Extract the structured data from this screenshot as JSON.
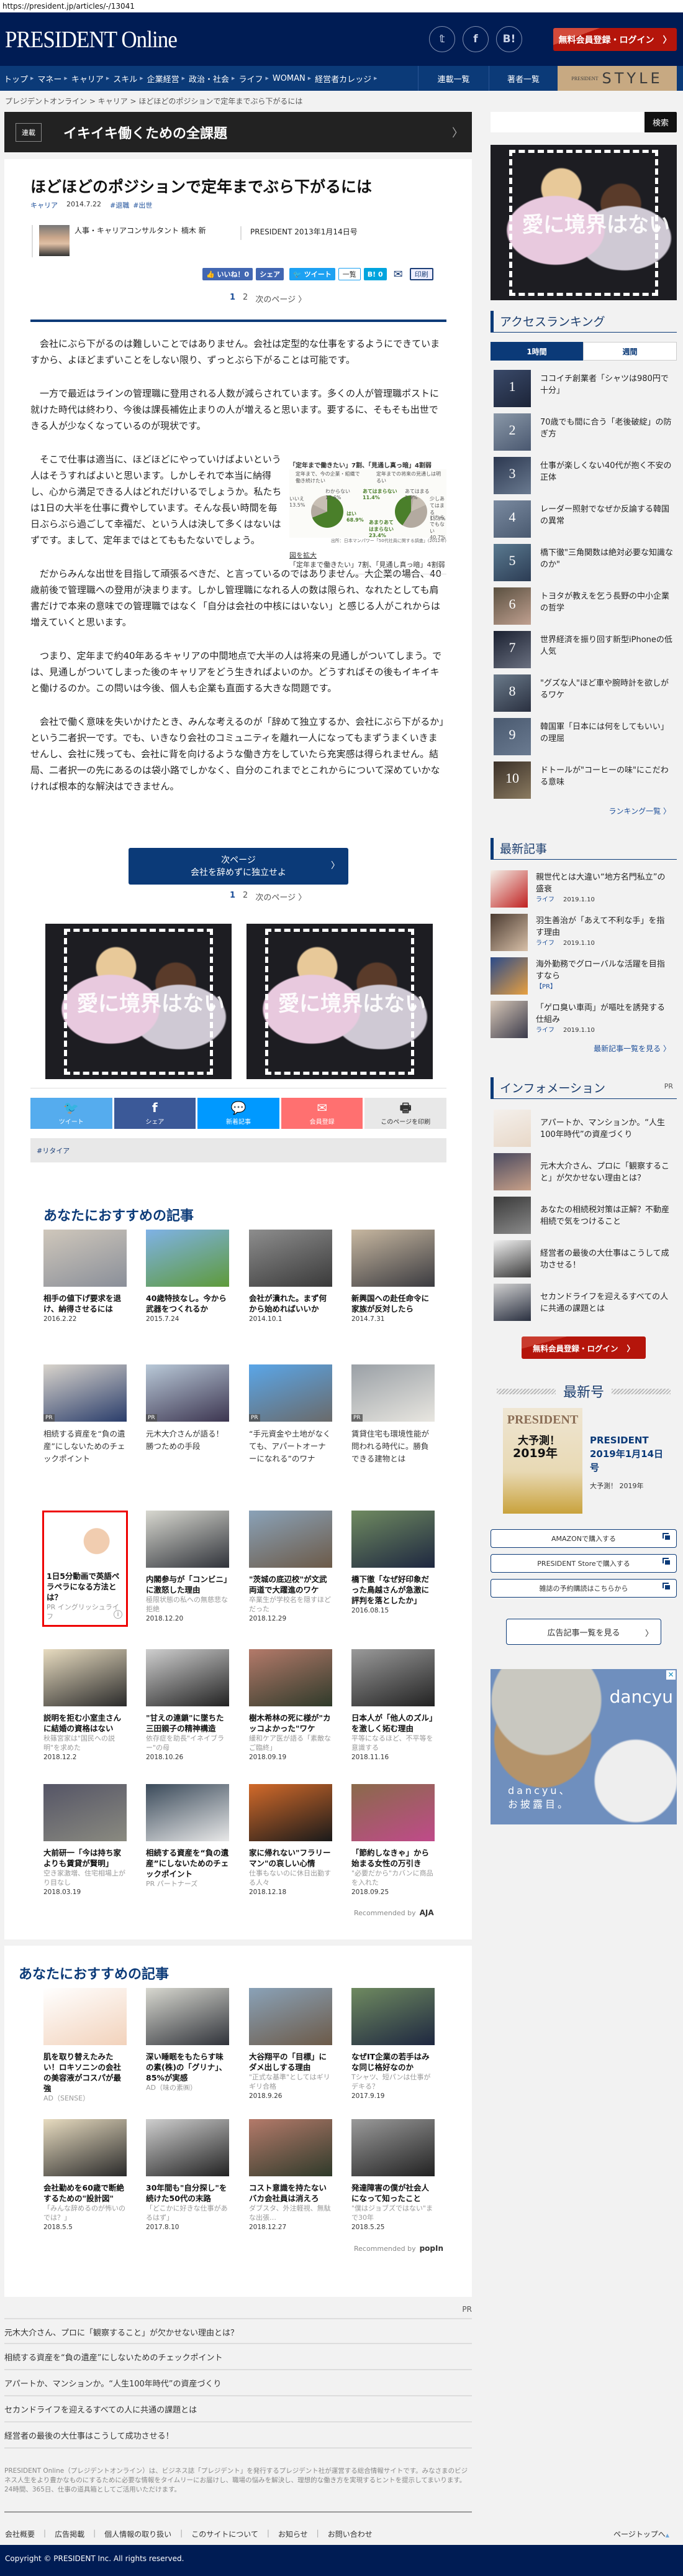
{
  "url": "https://president.jp/articles/-/13041",
  "header": {
    "logo": "PRESIDENT Online",
    "social": [
      {
        "icon": "twitter-icon",
        "label": "𝕥"
      },
      {
        "icon": "facebook-icon",
        "label": "f"
      },
      {
        "icon": "hatena-bookmark-icon",
        "label": "B!"
      }
    ],
    "login_label": "無料会員登録・ログイン",
    "login_chevron": "〉"
  },
  "nav": {
    "items": [
      "トップ",
      "マネー",
      "キャリア",
      "スキル",
      "企業経営",
      "政治・社会",
      "ライフ",
      "WOMAN",
      "経営者カレッジ"
    ],
    "series_list": "連載一覧",
    "authors_list": "著者一覧",
    "style_small": "PRESIDENT",
    "style_big": "STYLE"
  },
  "breadcrumb": "プレジデントオンライン  >  キャリア  >  ほどほどのポジションで定年までぶら下がるには",
  "series": {
    "tag": "連載",
    "title": "イキイキ働くための全課題",
    "chevron": "〉"
  },
  "article": {
    "title": "ほどほどのポジションで定年までぶら下がるには",
    "category": "キャリア",
    "date": "2014.7.22",
    "tags": [
      "#退職",
      "#出世"
    ],
    "author": "人事・キャリアコンサルタント 楠木 新",
    "issue": "PRESIDENT 2013年1月14日号",
    "share": {
      "like": "👍 いいね！0",
      "share": "シェア",
      "tweet": "🐦 ツイート",
      "list": "一覧",
      "hatena": "B! 0",
      "mail": "✉",
      "print": "印刷"
    },
    "pager": {
      "p1": "1",
      "p2": "2",
      "next": "次のページ 〉"
    },
    "paragraphs": [
      "会社にぶら下がるのは難しいことではありません。会社は定型的な仕事をするようにできていますから、よほどまずいことをしない限り、ずっとぶら下がることは可能です。",
      "一方で最近はラインの管理職に登用される人数が減らされています。多くの人が管理職ポストに就けた時代は終わり、今後は課長補佐止まりの人が増えると思います。要するに、そもそも出世できる人が少なくなっているのが現状です。",
      "そこで仕事は適当に、ほどほどにやっていけばよいという人はそうすればよいと思います。しかしそれで本当に納得し、心から満足できる人はどれだけいるでしょうか。私たちは1日の大半を仕事に費やしています。そんな長い時間を毎日ぶらぶら過ごして幸福だ、という人は決して多くはないはずです。まして、定年まではとてももたないでしょう。",
      "だからみんな出世を目指して頑張るべきだ、と言っているのではありません。大企業の場合、40歳前後で管理職への登用が決まります。しかし管理職になれる人の数は限られ、なれたとしても肩書だけで本来の意味での管理職ではなく「自分は会社の中核にはいない」と感じる人がこれからは増えていくと思います。",
      "つまり、定年まで約40年あるキャリアの中間地点で大半の人は将来の見通しがついてしまう。では、見通しがついてしまった後のキャリアをどう生きればよいのか。どうすればその後もイキイキと働けるのか。この問いは今後、個人も企業も直面する大きな問題です。",
      "会社で働く意味を失いかけたとき、みんな考えるのが「辞めて独立するか、会社にぶら下がるか」という二者択一です。でも、いきなり会社のコミュニティを離れ一人になってもまずうまくいきませんし、会社に残っても、会社に背を向けるような働き方をしていたら充実感は得られません。結局、二者択一の先にあるのは袋小路でしかなく、自分のこれまでとこれからについて深めていかなければ根本的な解決はできません。"
    ],
    "figure": {
      "title": "「定年まで働きたい」7割、「見通し真っ暗」4割弱",
      "left_q": "定年まで、今の企業・組織で働き続けたい",
      "right_q": "定年までの将来の見通しは明るい",
      "left_labels": [
        "いいえ 13.5%",
        "わからない 17.6%",
        "はい 68.9%"
      ],
      "right_labels": [
        "あてはまらない 11.4%",
        "あてはまる 2.9%",
        "少しあてはまる 15.3%",
        "あまりあてはまらない 23.4%",
        "どちらでもない 40.7%"
      ],
      "source": "出所：日本マンパワー「50代社員に関する調査」(2012年)",
      "zoom_link": "図を拡大",
      "caption": "「定年まで働きたい」7割、「見通し真っ暗」4割弱"
    },
    "next_button": {
      "line1": "次ページ",
      "line2": "会社を辞めずに独立せよ",
      "chevron": "〉"
    },
    "ad_copy": "愛に境界はない",
    "sharebar": [
      {
        "icon": "twitter-icon",
        "glyph": "🐦",
        "label": "ツイート",
        "color": "#55acee"
      },
      {
        "icon": "facebook-icon",
        "glyph": "f",
        "label": "シェア",
        "color": "#3b5998"
      },
      {
        "icon": "messenger-icon",
        "glyph": "💬",
        "label": "新着記事",
        "color": "#0099ff"
      },
      {
        "icon": "mail-icon",
        "glyph": "✉",
        "label": "会員登録",
        "color": "#ff7070"
      },
      {
        "icon": "printer-icon",
        "glyph": "🖶",
        "label": "このページを印刷",
        "color": "#e8e8e8"
      }
    ],
    "topic_tag": "#リタイア"
  },
  "recommend1": {
    "heading": "あなたにおすすめの記事",
    "cards": [
      {
        "title": "相手の値下げ要求を退け、納得させるには",
        "date": "2016.2.22"
      },
      {
        "title": "40歳特技なし。今から武器をつくれるか",
        "date": "2015.7.24"
      },
      {
        "title": "会社が潰れた。まず何から始めればいいか",
        "date": "2014.10.1"
      },
      {
        "title": "新興国への赴任命令に家族が反対したら",
        "date": "2014.7.31"
      },
      {
        "title": "相続する資産を“負の遺産”にしないためのチェックポイント",
        "pr": "PR",
        "light": true
      },
      {
        "title": "元木大介さんが語る！勝つための手段",
        "pr": "PR",
        "light": true
      },
      {
        "title": "“手元資金や土地がなくても、アパートオーナーになれる”のワナ",
        "pr": "PR",
        "light": true
      },
      {
        "title": "賃貸住宅も環境性能が問われる時代に。勝負できる建物とは",
        "pr": "PR",
        "light": true
      },
      {
        "title": "1日5分動画で英語ペラペラになる方法とは？",
        "sub": "PR イングリッシュライフ",
        "highlight": true
      },
      {
        "title": "内閣参与が「コンビニ」に激怒した理由",
        "sub": "極限状態の私への無慈悲な拒絶",
        "date": "2018.12.20"
      },
      {
        "title": "\"茨城の底辺校\"が文武両道で大躍進のワケ",
        "sub": "卒業生が学校名を隠すほどだった",
        "date": "2018.12.29"
      },
      {
        "title": "橋下徹「なぜ好印象だった鳥越さんが急激に評判を落としたか」",
        "date": "2016.08.15"
      },
      {
        "title": "説明を拒む小室圭さんに結婚の資格はない",
        "sub": "秋篠宮家は\"国民への説明\"を求めた",
        "date": "2018.12.2"
      },
      {
        "title": "\"甘えの連鎖\"に墜ちた三田親子の精神構造",
        "sub": "依存症を助長\"イネイブラー\"の母",
        "date": "2018.10.26"
      },
      {
        "title": "樹木希林の死に様が\"カッコよかった\"ワケ",
        "sub": "緩和ケア医が語る「素敵なご臨終」",
        "date": "2018.09.19"
      },
      {
        "title": "日本人が「他人のズル」を激しく妬む理由",
        "sub": "平等になるほど、不平等を意識する",
        "date": "2018.11.16"
      },
      {
        "title": "大前研一「今は持ち家よりも賃貸が賢明」",
        "sub": "空き家激増、住宅相場上がり目なし",
        "date": "2018.03.19"
      },
      {
        "title": "相続する資産を“負の遺産”にしないためのチェックポイント",
        "sub": "PR パートナーズ"
      },
      {
        "title": "家に帰れない\"フラリーマン\"の哀しい心情",
        "sub": "仕事もないのに休日出勤する人々",
        "date": "2018.12.18"
      },
      {
        "title": "「節約しなきゃ」から始まる女性の万引き",
        "sub": "\"必要だから\"カバンに商品を入れた",
        "date": "2018.09.25"
      }
    ],
    "recommended_by": "Recommended by",
    "provider": "AJA"
  },
  "recommend2": {
    "heading": "あなたにおすすめの記事",
    "cards": [
      {
        "title": "肌を取り替えたみたい！ロキソニンの会社の美容液がコスパが最強",
        "sub": "AD（SENSE）"
      },
      {
        "title": "深い睡眠をもたらす味の素(株)の「グリナ」、85%が実感",
        "sub": "AD（味の素㈱）"
      },
      {
        "title": "大谷翔平の「目標」にダメ出しする理由",
        "sub": "\"正式な基準\"としてはギリギリ合格",
        "date": "2018.9.26"
      },
      {
        "title": "なぜIT企業の若手はみな同じ格好なのか",
        "sub": "Tシャツ、短パンは仕事がデキる？",
        "date": "2017.9.19"
      },
      {
        "title": "会社勤めを60歳で断絶するための\"設計図\"",
        "sub": "「みんな辞めるのが怖いのでは？」",
        "date": "2018.5.5"
      },
      {
        "title": "30年間も\"自分探し\"を続けた50代の末路",
        "sub": "「どこかに好きな仕事があるはず」",
        "date": "2017.8.10"
      },
      {
        "title": "コスト意識を持たないバカ会社員は消えろ",
        "sub": "ダブスタ、外注軽視、無駄な出張…",
        "date": "2018.12.27"
      },
      {
        "title": "発達障害の僕が社会人になって知ったこと",
        "sub": "\"僕はジョブズではない\"まで30年",
        "date": "2018.5.25"
      }
    ],
    "recommended_by": "Recommended by",
    "provider": "popIn"
  },
  "pr_list": {
    "label": "PR",
    "items": [
      "元木大介さん、プロに「観察すること」が欠かせない理由とは？",
      "相続する資産を“負の遺産”にしないためのチェックポイント",
      "アパートか、マンションか。“人生100年時代”の資産づくり",
      "セカンドライフを迎えるすべての人に共通の課題とは",
      "経営者の最後の大仕事はこうして成功させる！"
    ]
  },
  "footer": {
    "about": "PRESIDENT Online（プレジデントオンライン）は、ビジネス誌「プレジデント」を発行するプレジデント社が運営する総合情報サイトです。みなさまのビジネス人生をより豊かなものにするために必要な情報をタイムリーにお届けし、職場の悩みを解決し、理想的な働き方を実現するヒントを提示してまいります。24時間、365日、仕事の道具箱としてご活用いただけます。",
    "links": [
      "会社概要",
      "広告掲載",
      "個人情報の取り扱い",
      "このサイトについて",
      "お知らせ",
      "お問い合わせ"
    ],
    "pagetop": "ページトップへ",
    "copyright": "Copyright © PRESIDENT Inc. All rights reserved."
  },
  "sidebar": {
    "search_button": "検索",
    "search_value": "",
    "ad_copy": "愛に境界はない",
    "ranking": {
      "heading": "アクセスランキング",
      "tabs": [
        "1時間",
        "週間"
      ],
      "items": [
        "ココイチ創業者「シャツは980円で十分」",
        "70歳でも間に合う「老後破綻」の防ぎ方",
        "仕事が楽しくない40代が抱く不安の正体",
        "レーダー照射でなぜか反論する韓国の異常",
        "橋下徹\"三角関数は絶対必要な知識なのか\"",
        "トヨタが教えを乞う長野の中小企業の哲学",
        "世界経済を振り回す新型iPhoneの低人気",
        "\"グズな人\"ほど車や腕時計を欲しがるワケ",
        "韓国軍「日本には何をしてもいい」の理屈",
        "ドトールが\"コーヒーの味\"にこだわる意味"
      ],
      "more": "ランキング一覧 〉"
    },
    "latest": {
      "heading": "最新記事",
      "items": [
        {
          "title": "親世代とは大違い“地方名門私立”の盛衰",
          "cat": "ライフ",
          "date": "2019.1.10"
        },
        {
          "title": "羽生善治が「あえて不利な手」を指す理由",
          "cat": "ライフ",
          "date": "2019.1.10"
        },
        {
          "title": "海外勤務でグローバルな活躍を目指すなら",
          "cat": "【PR】",
          "date": ""
        },
        {
          "title": "「ゲロ臭い車両」が嘔吐を誘発する仕組み",
          "cat": "ライフ",
          "date": "2019.1.10"
        }
      ],
      "more": "最新記事一覧を見る 〉"
    },
    "info": {
      "heading": "インフォメーション",
      "pr": "PR",
      "items": [
        "アパートか、マンションか。“人生100年時代”の資産づくり",
        "元木大介さん、プロに「観察すること」が欠かせない理由とは？",
        "あなたの相続税対策は正解？不動産相続で気をつけること",
        "経営者の最後の大仕事はこうして成功させる！",
        "セカンドライフを迎えるすべての人に共通の課題とは"
      ]
    },
    "login_label": "無料会員登録・ログイン",
    "login_chevron": "〉",
    "magazine": {
      "heading": "最新号",
      "cover_logo": "PRESIDENT",
      "cover_line1": "大予測！",
      "cover_line2": "2019年",
      "title": "PRESIDENT 2019年1月14日号",
      "subtitle": "大予測！ 2019年",
      "buttons": [
        "AMAZONで購入する",
        "PRESIDENT Storeで購入する",
        "雑誌の予約購読はこちらから"
      ]
    },
    "ad_list": "広告記事一覧を見る",
    "ad_list_chevron": "〉",
    "dancyu": {
      "logo": "dancyu",
      "copy1": "dancyu、",
      "copy2": "お披露目。",
      "close": "✕"
    }
  }
}
